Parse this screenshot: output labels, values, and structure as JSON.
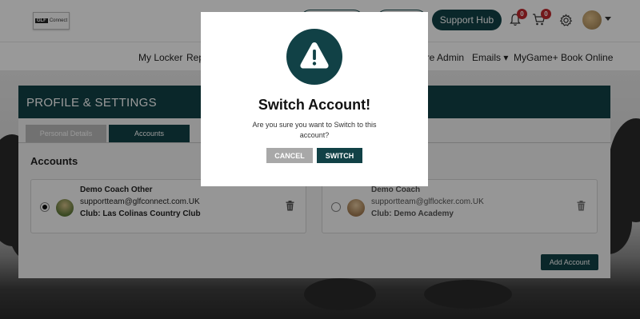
{
  "header": {
    "logo_text": "Connect",
    "logo_mark": "GLF",
    "support_label": "Support Hub",
    "notifications_count": "0",
    "cart_count": "0"
  },
  "nav": {
    "items": [
      {
        "label": "My Locker"
      },
      {
        "label": "Rep"
      },
      {
        "label": "ore Admin"
      },
      {
        "label": "Emails"
      },
      {
        "label": "MyGame+"
      },
      {
        "label": "Book Online"
      }
    ]
  },
  "page": {
    "title": "PROFILE & SETTINGS",
    "tabs": [
      {
        "label": "Personal Details"
      },
      {
        "label": "Accounts"
      }
    ],
    "section_title": "Accounts",
    "accounts": [
      {
        "name": "Demo Coach Other",
        "email": "supportteam@glfconnect.com.UK",
        "club": "Club: Las Colinas Country Club"
      },
      {
        "name": "Demo Coach",
        "email": "supportteam@glflocker.com.UK",
        "club": "Club: Demo Academy"
      }
    ],
    "add_account_label": "Add Account"
  },
  "modal": {
    "title": "Switch Account!",
    "message": "Are you sure you want to Switch to this account?",
    "cancel_label": "CANCEL",
    "switch_label": "SWITCH"
  },
  "colors": {
    "brand": "#114146",
    "badge": "#c0282d",
    "cancel": "#a8a8a8"
  }
}
